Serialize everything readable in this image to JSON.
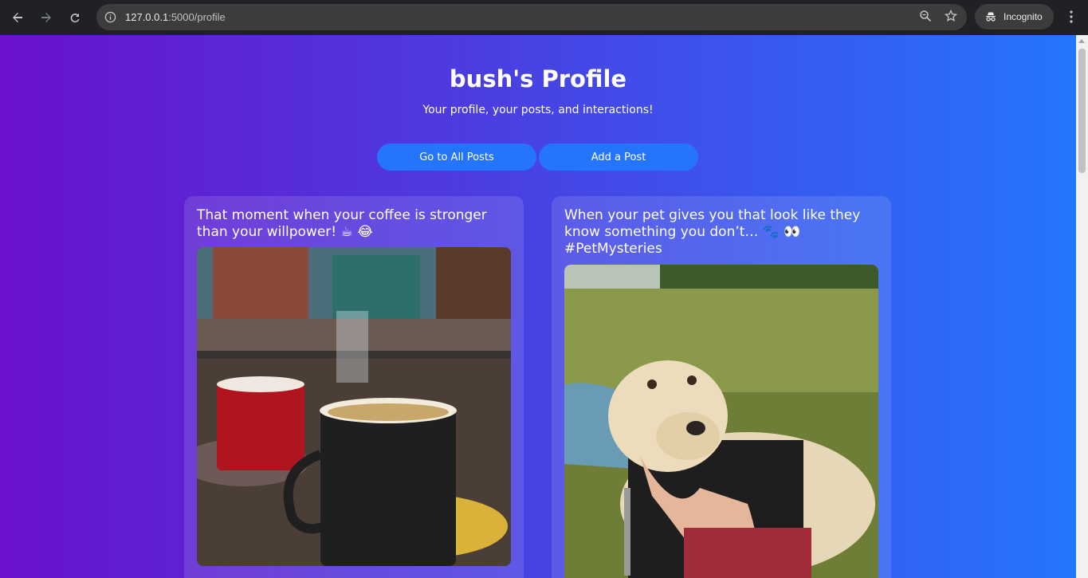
{
  "browser": {
    "url_host": "127.0.0.1",
    "url_path": ":5000/profile",
    "incognito_label": "Incognito"
  },
  "header": {
    "title": "bush's Profile",
    "subtitle": "Your profile, your posts, and interactions!"
  },
  "actions": {
    "all_posts_label": "Go to All Posts",
    "add_post_label": "Add a Post"
  },
  "posts": [
    {
      "text": "That moment when your coffee is stronger than your willpower! ☕ 😂",
      "image_icon": "coffee-cups-photo"
    },
    {
      "text": "When your pet gives you that look like they know something you don’t… 🐾 👀 #PetMysteries",
      "image_icon": "dog-photo"
    }
  ],
  "colors": {
    "gradient_start": "#6a11cb",
    "gradient_end": "#2575fc",
    "button": "#2575fc"
  }
}
